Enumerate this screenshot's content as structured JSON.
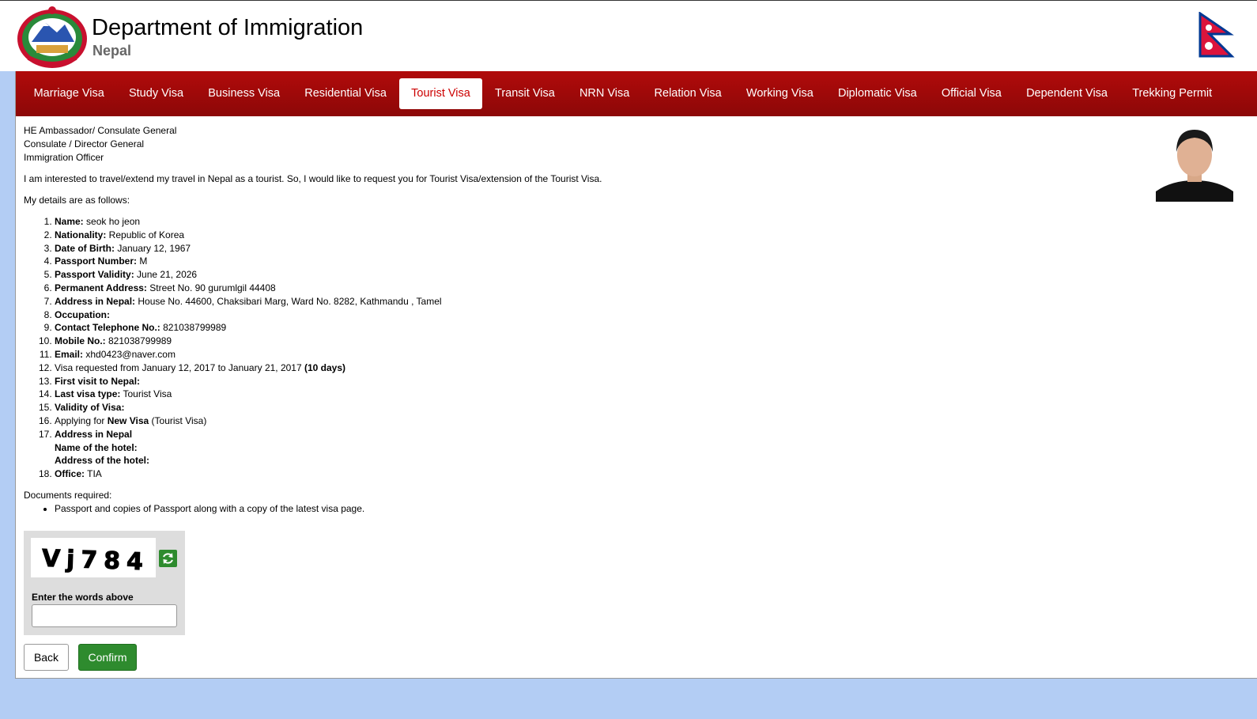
{
  "header": {
    "title": "Department of Immigration",
    "subtitle": "Nepal"
  },
  "nav": {
    "items": [
      {
        "label": "Marriage Visa",
        "active": false
      },
      {
        "label": "Study Visa",
        "active": false
      },
      {
        "label": "Business Visa",
        "active": false
      },
      {
        "label": "Residential Visa",
        "active": false
      },
      {
        "label": "Tourist Visa",
        "active": true
      },
      {
        "label": "Transit Visa",
        "active": false
      },
      {
        "label": "NRN Visa",
        "active": false
      },
      {
        "label": "Relation Visa",
        "active": false
      },
      {
        "label": "Working Visa",
        "active": false
      },
      {
        "label": "Diplomatic Visa",
        "active": false
      },
      {
        "label": "Official Visa",
        "active": false
      },
      {
        "label": "Dependent Visa",
        "active": false
      },
      {
        "label": "Trekking Permit",
        "active": false
      }
    ]
  },
  "letter": {
    "addressee": [
      "HE Ambassador/ Consulate General",
      "Consulate / Director General",
      "Immigration Officer"
    ],
    "intro": "I am interested to travel/extend my travel in Nepal as a tourist. So, I would like to request you for Tourist Visa/extension of the Tourist Visa.",
    "details_heading": "My details are as follows:",
    "details": [
      {
        "label": "Name:",
        "value": " seok ho jeon"
      },
      {
        "label": "Nationality:",
        "value": " Republic of Korea"
      },
      {
        "label": "Date of Birth:",
        "value": " January 12, 1967"
      },
      {
        "label": "Passport Number:",
        "value": " M"
      },
      {
        "label": "Passport Validity:",
        "value": " June 21, 2026"
      },
      {
        "label": "Permanent Address:",
        "value": " Street No. 90 gurumlgil 44408"
      },
      {
        "label": "Address in Nepal:",
        "value": " House No. 44600, Chaksibari Marg, Ward No. 8282, Kathmandu , Tamel"
      },
      {
        "label": "Occupation:",
        "value": ""
      },
      {
        "label": "Contact Telephone No.:",
        "value": " 821038799989"
      },
      {
        "label": "Mobile No.:",
        "value": " 821038799989"
      },
      {
        "label": "Email:",
        "value": " xhd0423@naver.com"
      }
    ],
    "visa_requested": {
      "text": "Visa requested from January 12, 2017 to January 21, 2017 ",
      "days": "(10 days)"
    },
    "first_visit": "First visit to Nepal:",
    "last_visa_label": "Last visa type:",
    "last_visa_value": " Tourist Visa",
    "validity_label": "Validity of Visa:",
    "applying": {
      "prefix": "Applying for ",
      "bold": "New Visa",
      "suffix": " (Tourist Visa)"
    },
    "address_nepal_label": "Address in Nepal",
    "hotel_name_label": "Name of the hotel:",
    "hotel_address_label": "Address of the hotel:",
    "office_label": "Office:",
    "office_value": " TIA",
    "documents_heading": "Documents required:",
    "documents": [
      "Passport and copies of Passport along with a copy of the latest visa page."
    ]
  },
  "captcha": {
    "code": "Vj784",
    "label": "Enter the words above",
    "input_value": ""
  },
  "buttons": {
    "back": "Back",
    "confirm": "Confirm"
  },
  "colors": {
    "nav_red": "#b10a0a",
    "confirm_green": "#2e8b2e",
    "page_blue": "#b3cdf4"
  }
}
